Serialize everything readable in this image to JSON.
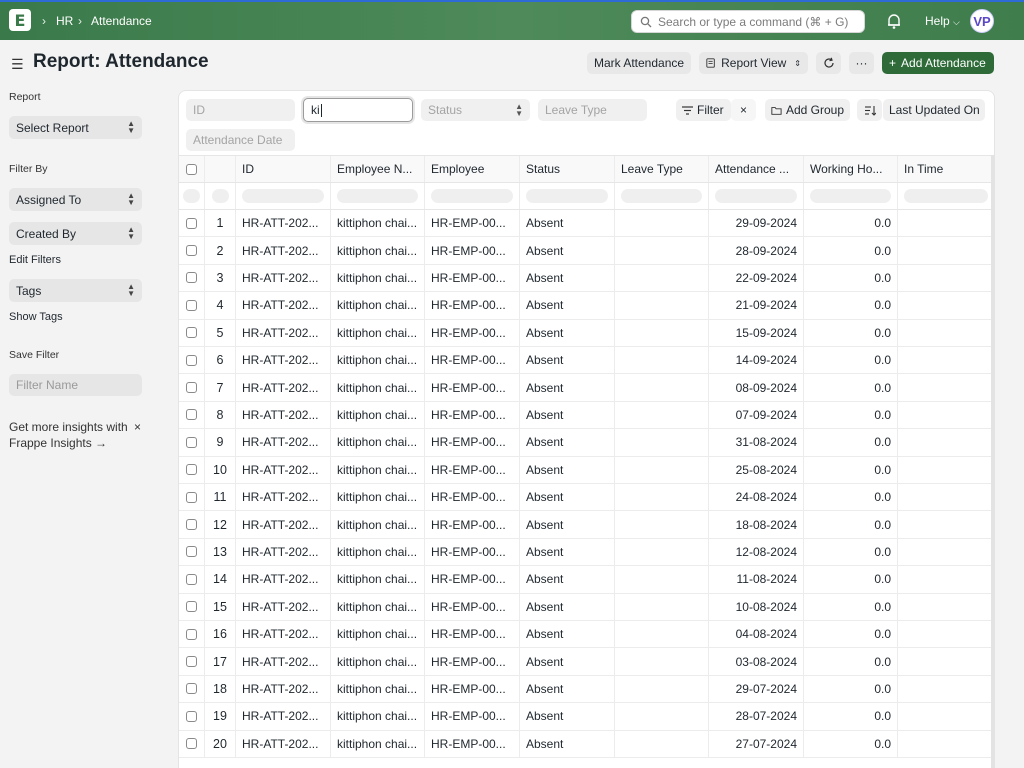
{
  "navbar": {
    "logo_letter": "E",
    "breadcrumbs": [
      "HR",
      "Attendance"
    ],
    "search_placeholder": "Search or type a command (⌘ + G)",
    "help_label": "Help",
    "avatar_initials": "VP"
  },
  "page": {
    "title": "Report: Attendance",
    "buttons": {
      "mark_attendance": "Mark Attendance",
      "report_view": "Report View",
      "more": "···",
      "add_attendance": "Add Attendance"
    }
  },
  "sidebar": {
    "report_label": "Report",
    "select_report": "Select Report",
    "filter_by_label": "Filter By",
    "assigned_to": "Assigned To",
    "created_by": "Created By",
    "edit_filters": "Edit Filters",
    "tags": "Tags",
    "show_tags": "Show Tags",
    "save_filter_label": "Save Filter",
    "filter_name_placeholder": "Filter Name",
    "insights_text": "Get more insights with Frappe Insights →",
    "insights_close": "×"
  },
  "filters": {
    "id_placeholder": "ID",
    "employee_value": "ki",
    "status_placeholder": "Status",
    "leave_type_placeholder": "Leave Type",
    "filter_label": "Filter",
    "clear_label": "×",
    "add_group_label": "Add Group",
    "sort_label": "Last Updated On",
    "attendance_date_placeholder": "Attendance Date"
  },
  "columns": [
    "ID",
    "Employee N...",
    "Employee",
    "Status",
    "Leave Type",
    "Attendance ...",
    "Working Ho...",
    "In Time"
  ],
  "rows": [
    {
      "n": "1",
      "id": "HR-ATT-202...",
      "name": "kittiphon chai...",
      "emp": "HR-EMP-00...",
      "status": "Absent",
      "leave": "",
      "date": "29-09-2024",
      "hours": "0.0",
      "in": ""
    },
    {
      "n": "2",
      "id": "HR-ATT-202...",
      "name": "kittiphon chai...",
      "emp": "HR-EMP-00...",
      "status": "Absent",
      "leave": "",
      "date": "28-09-2024",
      "hours": "0.0",
      "in": ""
    },
    {
      "n": "3",
      "id": "HR-ATT-202...",
      "name": "kittiphon chai...",
      "emp": "HR-EMP-00...",
      "status": "Absent",
      "leave": "",
      "date": "22-09-2024",
      "hours": "0.0",
      "in": ""
    },
    {
      "n": "4",
      "id": "HR-ATT-202...",
      "name": "kittiphon chai...",
      "emp": "HR-EMP-00...",
      "status": "Absent",
      "leave": "",
      "date": "21-09-2024",
      "hours": "0.0",
      "in": ""
    },
    {
      "n": "5",
      "id": "HR-ATT-202...",
      "name": "kittiphon chai...",
      "emp": "HR-EMP-00...",
      "status": "Absent",
      "leave": "",
      "date": "15-09-2024",
      "hours": "0.0",
      "in": ""
    },
    {
      "n": "6",
      "id": "HR-ATT-202...",
      "name": "kittiphon chai...",
      "emp": "HR-EMP-00...",
      "status": "Absent",
      "leave": "",
      "date": "14-09-2024",
      "hours": "0.0",
      "in": ""
    },
    {
      "n": "7",
      "id": "HR-ATT-202...",
      "name": "kittiphon chai...",
      "emp": "HR-EMP-00...",
      "status": "Absent",
      "leave": "",
      "date": "08-09-2024",
      "hours": "0.0",
      "in": ""
    },
    {
      "n": "8",
      "id": "HR-ATT-202...",
      "name": "kittiphon chai...",
      "emp": "HR-EMP-00...",
      "status": "Absent",
      "leave": "",
      "date": "07-09-2024",
      "hours": "0.0",
      "in": ""
    },
    {
      "n": "9",
      "id": "HR-ATT-202...",
      "name": "kittiphon chai...",
      "emp": "HR-EMP-00...",
      "status": "Absent",
      "leave": "",
      "date": "31-08-2024",
      "hours": "0.0",
      "in": ""
    },
    {
      "n": "10",
      "id": "HR-ATT-202...",
      "name": "kittiphon chai...",
      "emp": "HR-EMP-00...",
      "status": "Absent",
      "leave": "",
      "date": "25-08-2024",
      "hours": "0.0",
      "in": ""
    },
    {
      "n": "11",
      "id": "HR-ATT-202...",
      "name": "kittiphon chai...",
      "emp": "HR-EMP-00...",
      "status": "Absent",
      "leave": "",
      "date": "24-08-2024",
      "hours": "0.0",
      "in": ""
    },
    {
      "n": "12",
      "id": "HR-ATT-202...",
      "name": "kittiphon chai...",
      "emp": "HR-EMP-00...",
      "status": "Absent",
      "leave": "",
      "date": "18-08-2024",
      "hours": "0.0",
      "in": ""
    },
    {
      "n": "13",
      "id": "HR-ATT-202...",
      "name": "kittiphon chai...",
      "emp": "HR-EMP-00...",
      "status": "Absent",
      "leave": "",
      "date": "12-08-2024",
      "hours": "0.0",
      "in": ""
    },
    {
      "n": "14",
      "id": "HR-ATT-202...",
      "name": "kittiphon chai...",
      "emp": "HR-EMP-00...",
      "status": "Absent",
      "leave": "",
      "date": "11-08-2024",
      "hours": "0.0",
      "in": ""
    },
    {
      "n": "15",
      "id": "HR-ATT-202...",
      "name": "kittiphon chai...",
      "emp": "HR-EMP-00...",
      "status": "Absent",
      "leave": "",
      "date": "10-08-2024",
      "hours": "0.0",
      "in": ""
    },
    {
      "n": "16",
      "id": "HR-ATT-202...",
      "name": "kittiphon chai...",
      "emp": "HR-EMP-00...",
      "status": "Absent",
      "leave": "",
      "date": "04-08-2024",
      "hours": "0.0",
      "in": ""
    },
    {
      "n": "17",
      "id": "HR-ATT-202...",
      "name": "kittiphon chai...",
      "emp": "HR-EMP-00...",
      "status": "Absent",
      "leave": "",
      "date": "03-08-2024",
      "hours": "0.0",
      "in": ""
    },
    {
      "n": "18",
      "id": "HR-ATT-202...",
      "name": "kittiphon chai...",
      "emp": "HR-EMP-00...",
      "status": "Absent",
      "leave": "",
      "date": "29-07-2024",
      "hours": "0.0",
      "in": ""
    },
    {
      "n": "19",
      "id": "HR-ATT-202...",
      "name": "kittiphon chai...",
      "emp": "HR-EMP-00...",
      "status": "Absent",
      "leave": "",
      "date": "28-07-2024",
      "hours": "0.0",
      "in": ""
    },
    {
      "n": "20",
      "id": "HR-ATT-202...",
      "name": "kittiphon chai...",
      "emp": "HR-EMP-00...",
      "status": "Absent",
      "leave": "",
      "date": "27-07-2024",
      "hours": "0.0",
      "in": ""
    }
  ],
  "colors": {
    "navbar": "#3f7d4d",
    "primary_button": "#2e6b39",
    "top_accent": "#2f6bd6"
  }
}
